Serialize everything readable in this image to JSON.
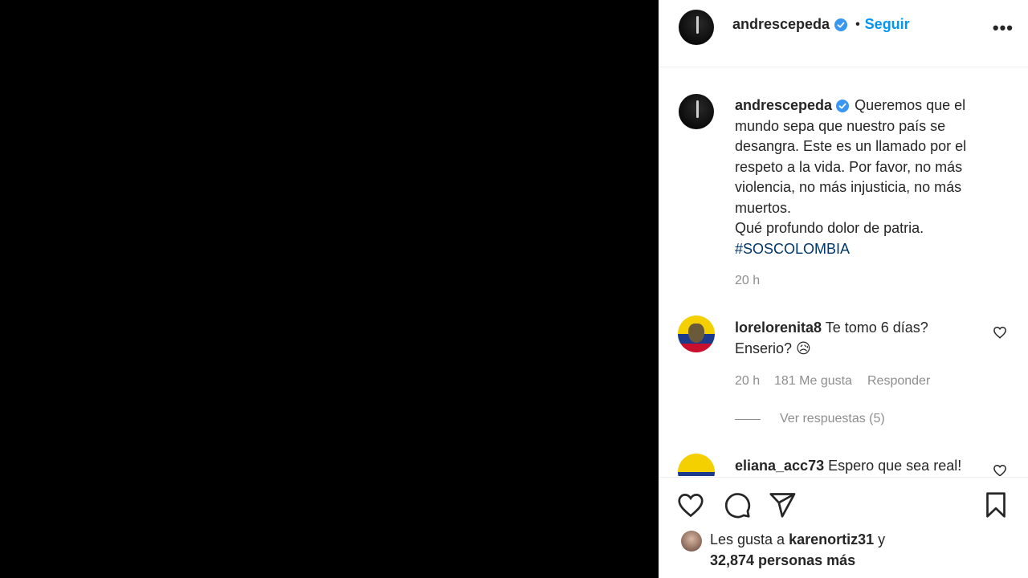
{
  "post": {
    "username": "andrescepeda",
    "follow_label": "Seguir",
    "more_label": "•••"
  },
  "caption": {
    "username": "andrescepeda",
    "text": "Queremos que el\nmundo sepa que nuestro país se\ndesangra. Este es un llamado por el\nrespeto a la vida. Por favor, no más\nviolencia, no más injusticia, no más\nmuertos.\nQué profundo dolor de patria.\n",
    "hashtag": "#SOSCOLOMBIA",
    "time": "20 h"
  },
  "comments": [
    {
      "username": "lorelorenita8",
      "text": "Te tomo 6 días?\nEnserio? 😥",
      "time": "20 h",
      "likes": "181 Me gusta",
      "reply_label": "Responder",
      "view_replies": "Ver respuestas (5)"
    },
    {
      "username": "eliana_acc73",
      "text": "Espero que sea real!"
    }
  ],
  "likes": {
    "prefix": "Les gusta a",
    "user": "karenortiz31",
    "conj": "y",
    "others": "32,874 personas más"
  },
  "colors": {
    "accent": "#0095f6",
    "verified": "#3897f0",
    "hashtag": "#00376b",
    "muted": "#8e8e8e",
    "text": "#262626"
  },
  "icons": [
    "verified-icon",
    "more-icon",
    "heart-icon",
    "comment-icon",
    "share-icon",
    "bookmark-icon"
  ]
}
